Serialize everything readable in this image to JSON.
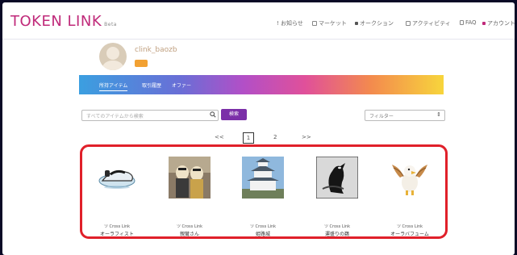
{
  "app": {
    "logo_main": "TOKEN LINK",
    "logo_suffix": "Beta"
  },
  "nav": [
    {
      "label": "! お知らせ",
      "icon": "bell-icon"
    },
    {
      "label": "マーケット",
      "icon": "store-icon"
    },
    {
      "label": "オークション",
      "icon": "gavel-icon"
    },
    {
      "label": "アクティビティ",
      "icon": "activity-icon"
    },
    {
      "label": "FAQ",
      "icon": "faq-icon"
    },
    {
      "label": "アカウント",
      "icon": "account-icon"
    }
  ],
  "profile": {
    "username": "clink_baozb"
  },
  "tabs": [
    "所持アイテム",
    "取引履歴",
    "オファー"
  ],
  "search": {
    "placeholder": "すべてのアイテムから検索",
    "button": "検索"
  },
  "filter": {
    "label": "フィルター",
    "arrow": "⇕"
  },
  "pagination": {
    "prev": "<<",
    "pages": [
      "1",
      "2"
    ],
    "current": "1",
    "next": ">>"
  },
  "items": [
    {
      "brand": "ツ Cross Link",
      "name": "オーラフィスト",
      "image": "hovercraft-image"
    },
    {
      "brand": "ツ Cross Link",
      "name": "親鸞さん",
      "image": "figures-image"
    },
    {
      "brand": "ツ Cross Link",
      "name": "姫路城",
      "image": "castle-image"
    },
    {
      "brand": "ツ Cross Link",
      "name": "運盛りの鵜",
      "image": "cormorant-image"
    },
    {
      "brand": "ツ Cross Link",
      "name": "オーラバフューム",
      "image": "eagle-image"
    }
  ]
}
